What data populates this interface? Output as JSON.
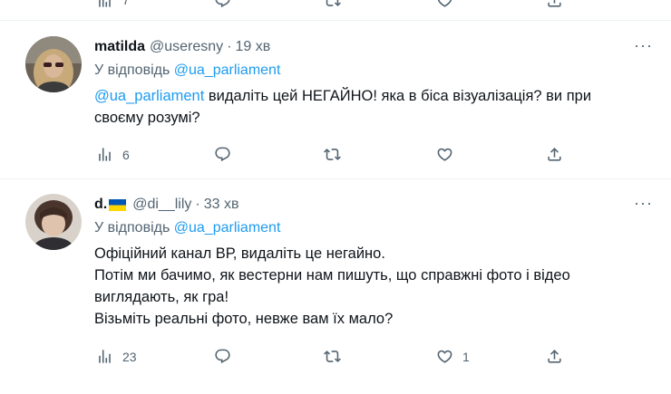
{
  "previous": {
    "views": "7"
  },
  "tweets": [
    {
      "name": "matilda",
      "handle": "@useresny",
      "dot": "·",
      "time": "19 хв",
      "reply_prefix": "У відповідь",
      "reply_to": "@ua_parliament",
      "mention": "@ua_parliament",
      "text": " видаліть цей НЕГАЙНО! яка в біса візуалізація? ви при своєму розумі?",
      "views": "6",
      "more": "···"
    },
    {
      "name": "d.",
      "handle": "@di__lily",
      "dot": "·",
      "time": "33 хв",
      "reply_prefix": "У відповідь",
      "reply_to": "@ua_parliament",
      "lines": [
        "Офіційний канал ВР, видаліть це негайно.",
        "Потім ми бачимо, як вестерни нам пишуть, що справжні фото і відео виглядають, як гра!",
        "Візьміть реальні фото, невже вам їх мало?"
      ],
      "views": "23",
      "likes": "1",
      "more": "···"
    }
  ],
  "icons": [
    "views-icon",
    "reply-icon",
    "retweet-icon",
    "like-icon",
    "share-icon",
    "more-icon",
    "ukraine-flag-icon"
  ],
  "colors": {
    "link": "#1d9bf0",
    "muted": "#536471",
    "text": "#0f1419",
    "divider": "#eff3f4",
    "flag_blue": "#0057b7",
    "flag_yellow": "#ffd700"
  }
}
